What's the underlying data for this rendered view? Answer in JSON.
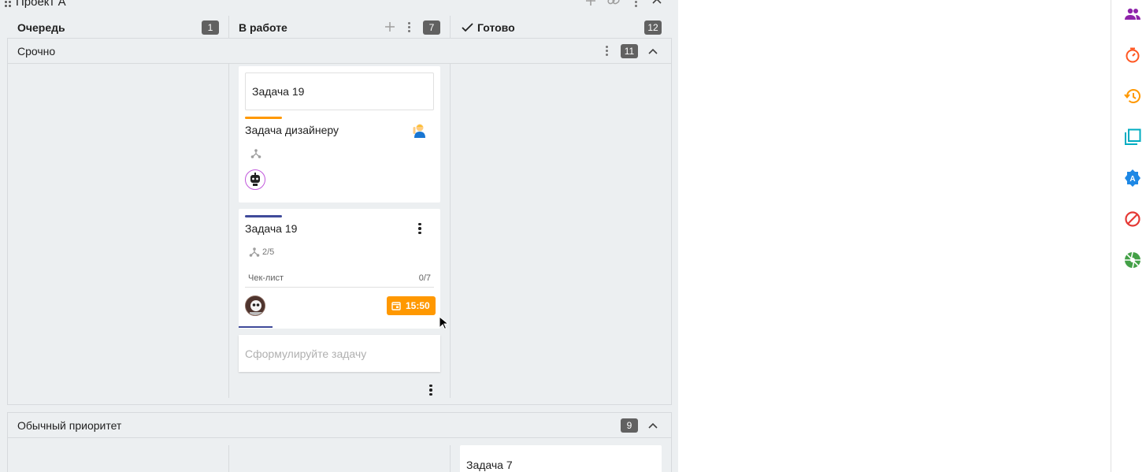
{
  "project": {
    "title": "Проект А"
  },
  "columns": [
    {
      "title": "Очередь",
      "count": "1"
    },
    {
      "title": "В работе",
      "count": "7"
    },
    {
      "title": "Готово",
      "count": "12"
    }
  ],
  "lanes": {
    "urgent": {
      "title": "Срочно",
      "count": "11"
    },
    "normal": {
      "title": "Обычный приоритет",
      "count": "9"
    }
  },
  "cards": {
    "subtask_title": "Задача 19",
    "designer_task": {
      "title": "Задача дизайнеру",
      "priority_color": "#ff9800"
    },
    "task19": {
      "title": "Задача 19",
      "subtasks": "2/5",
      "checklist_label": "Чек-лист",
      "checklist_progress": "0/7",
      "due_time": "15:50",
      "priority_color": "#3f4a9a"
    },
    "new_task_placeholder": "Сформулируйте задачу",
    "task7": {
      "title": "Задача 7"
    }
  },
  "sidebar": {
    "icons": [
      {
        "name": "team-icon",
        "color": "#8e24aa"
      },
      {
        "name": "timer-icon",
        "color": "#ff5722"
      },
      {
        "name": "history-icon",
        "color": "#ff9800"
      },
      {
        "name": "layers-icon",
        "color": "#00acc1"
      },
      {
        "name": "badge-a-icon",
        "color": "#1e88e5"
      },
      {
        "name": "blocked-icon",
        "color": "#e53935"
      },
      {
        "name": "aperture-icon",
        "color": "#43a047"
      }
    ]
  }
}
